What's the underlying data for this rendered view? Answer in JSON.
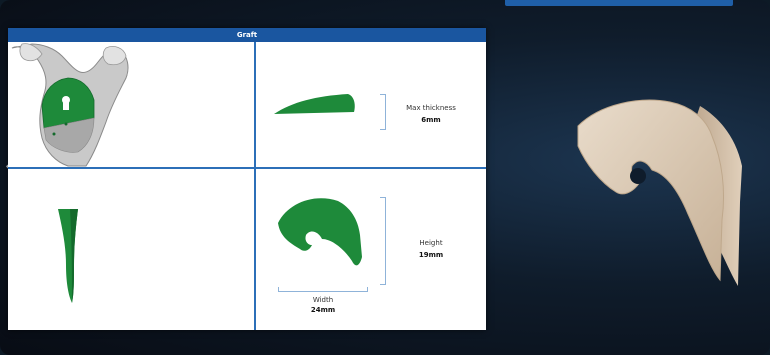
{
  "panel": {
    "title": "Graft",
    "max_thickness": {
      "label": "Max thickness",
      "value": "6mm"
    },
    "height": {
      "label": "Height",
      "value": "19mm"
    },
    "width": {
      "label": "Width",
      "value": "24mm"
    }
  },
  "colors": {
    "header": "#1a56a0",
    "graft_green": "#1e8a3a",
    "bone": "#d6c2aa"
  },
  "icons": {
    "left_nav": "chevron-left-icon"
  }
}
